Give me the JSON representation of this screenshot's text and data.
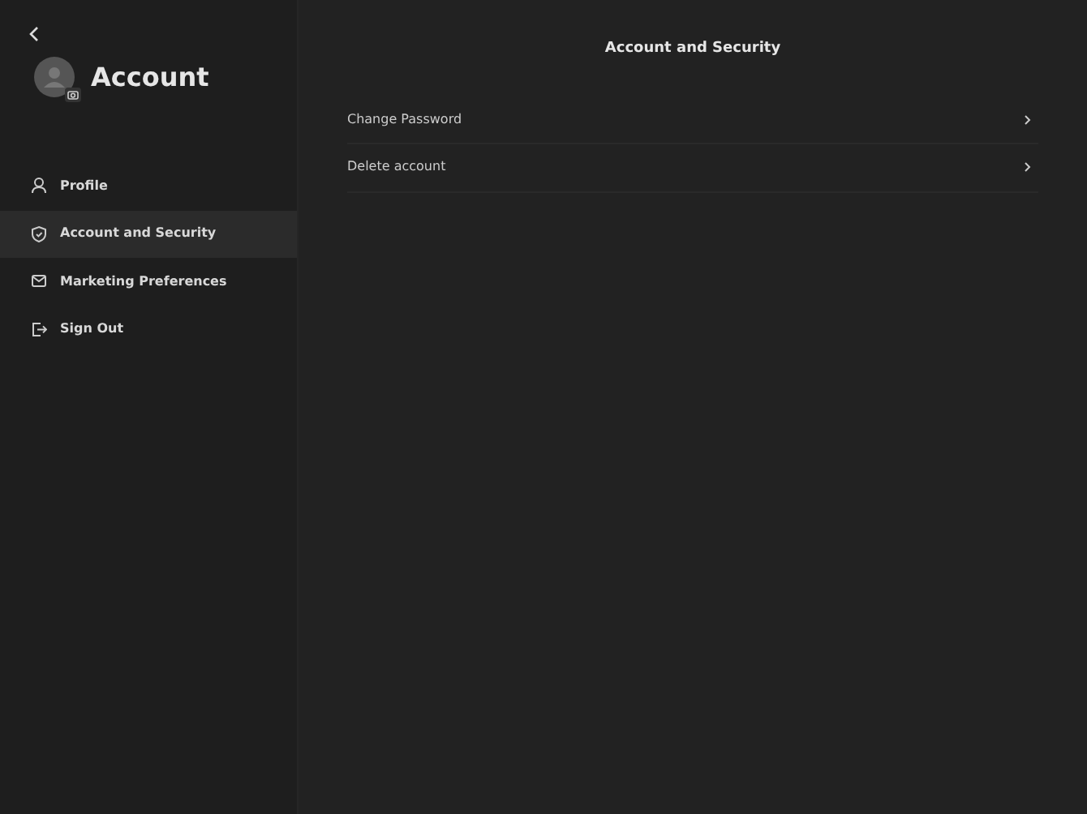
{
  "sidebar": {
    "title": "Account",
    "items": [
      {
        "label": "Profile",
        "kind": "profile",
        "selected": false
      },
      {
        "label": "Account and Security",
        "kind": "security",
        "selected": true
      },
      {
        "label": "Marketing Preferences",
        "kind": "mail",
        "selected": false
      },
      {
        "label": "Sign Out",
        "kind": "signout",
        "selected": false
      }
    ]
  },
  "main": {
    "title": "Account and Security",
    "rows": [
      {
        "label": "Change Password"
      },
      {
        "label": "Delete account"
      }
    ]
  }
}
